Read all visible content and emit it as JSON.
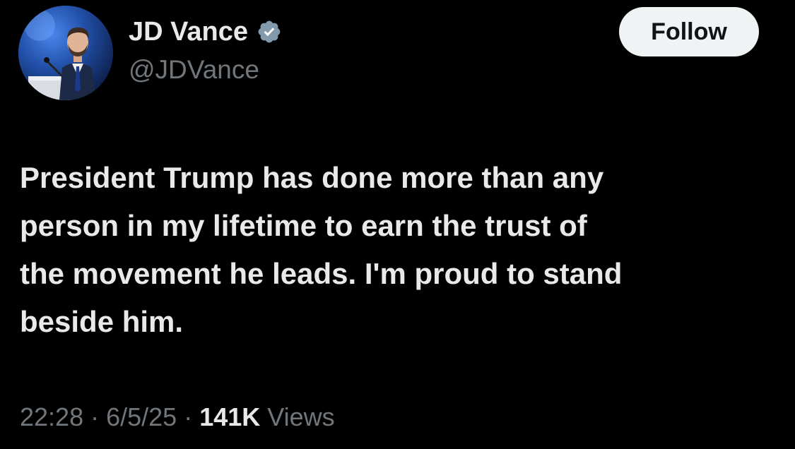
{
  "author": {
    "display_name": "JD Vance",
    "handle": "@JDVance",
    "avatar_icon": "profile-photo-speaker-at-podium",
    "verified_icon": "verified-badge-icon",
    "verified_color": "#829aab"
  },
  "follow_button": {
    "label": "Follow"
  },
  "tweet": {
    "text": "President Trump has done more than any\nperson in my lifetime to earn the trust of\nthe movement he leads. I'm proud to stand\nbeside him."
  },
  "meta": {
    "time": "22:28",
    "date": "6/5/25",
    "separator": "·",
    "views_count": "141K",
    "views_label": "Views"
  },
  "colors": {
    "background": "#000000",
    "primary_text": "#e7e9ea",
    "secondary_text": "#71767b",
    "button_bg": "#eff3f4",
    "button_text": "#0f1419"
  }
}
